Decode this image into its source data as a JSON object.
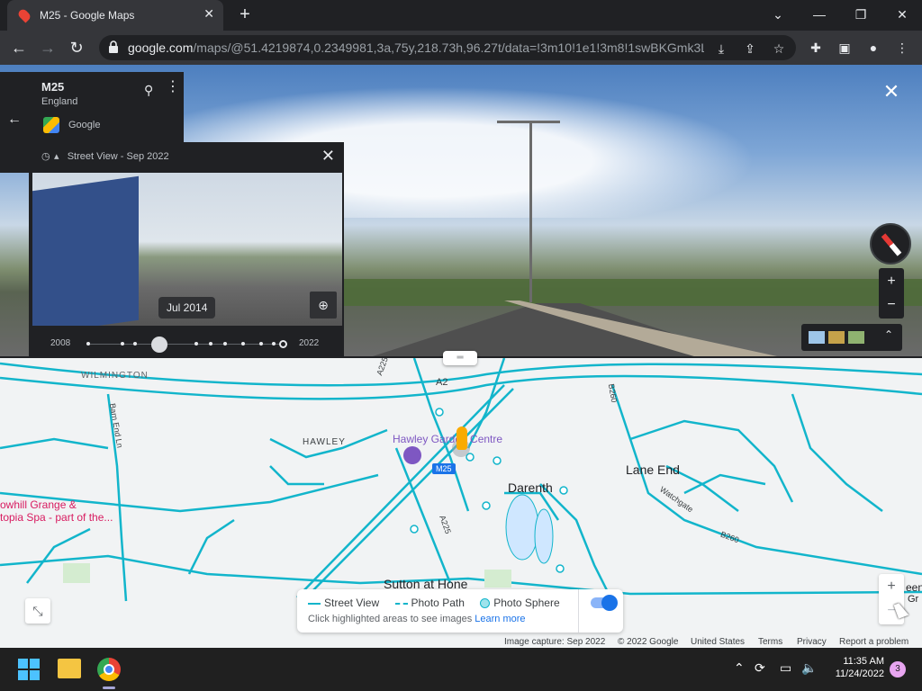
{
  "browser": {
    "tab_title": "M25 - Google Maps",
    "url_host": "google.com",
    "url_rest": "/maps/@51.4219874,0.2349981,3a,75y,218.73h,96.27t/data=!3m10!1e1!3m8!1swBKGmk3L..."
  },
  "place": {
    "name": "M25",
    "region": "England",
    "provider": "Google"
  },
  "time_machine": {
    "header": "Street View - Sep 2022",
    "selected_date": "Jul 2014",
    "start_year": "2008",
    "end_year": "2022"
  },
  "map_labels": {
    "wilmington": "WILMINGTON",
    "a2": "A2",
    "b260_top": "B260",
    "barn_end": "Barn End Ln",
    "hawley": "HAWLEY",
    "hawley_garden": "Hawley Garden Centre",
    "m25": "M25",
    "darenth": "Darenth",
    "lane_end": "Lane End",
    "watchgate": "Watchgate",
    "a225_top": "A225",
    "a225_bottom": "A225",
    "b260_right": "B260",
    "sutton": "Sutton at Hone",
    "spa": "owhill Grange &",
    "spa2": "topia Spa - part of the...",
    "green": "een",
    "green2": "Gr"
  },
  "legend": {
    "street_view": "Street View",
    "photo_path": "Photo Path",
    "photo_sphere": "Photo Sphere",
    "hint": "Click highlighted areas to see images",
    "learn_more": "Learn more"
  },
  "footer": {
    "capture": "Image capture: Sep 2022",
    "copyright": "© 2022 Google",
    "country": "United States",
    "terms": "Terms",
    "privacy": "Privacy",
    "report": "Report a problem"
  },
  "taskbar": {
    "time": "11:35 AM",
    "date": "11/24/2022",
    "notifications": "3"
  },
  "colors": {
    "coverage": "#12b5cb",
    "accent": "#1a73e8"
  }
}
